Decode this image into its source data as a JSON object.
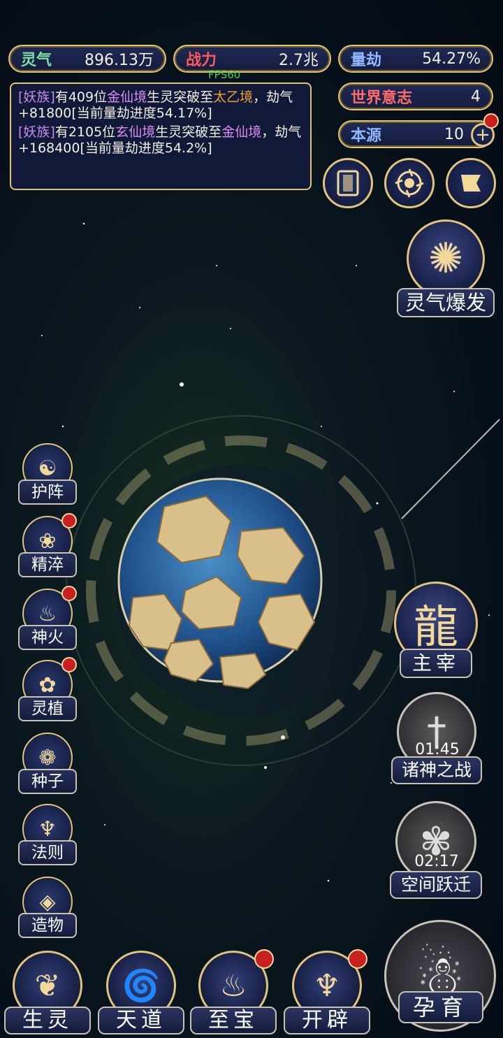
{
  "stats": {
    "lingqi": {
      "label": "灵气",
      "value": "896.13万",
      "color": "#7ee0a0"
    },
    "zhanli": {
      "label": "战力",
      "value": "2.7兆",
      "color": "#ff5a5a"
    },
    "liangjie": {
      "label": "量劫",
      "value": "54.27%",
      "color": "#8fb8ff"
    },
    "world_will": {
      "label": "世界意志",
      "value": "4",
      "color": "#ff6b6b"
    },
    "origin": {
      "label": "本源",
      "value": "10",
      "color": "#8fb8ff"
    }
  },
  "fps": "FPS60",
  "log": {
    "entry1": {
      "race": "[妖族]",
      "p1": "有409位",
      "realm_from": "金仙境",
      "p2": "生灵突破至",
      "realm_to": "太乙境",
      "p3": "，劫气+81800[当前量劫进度54.17%]"
    },
    "entry2": {
      "race": "[妖族]",
      "p1": "有2105位",
      "realm_from": "玄仙境",
      "p2": "生灵突破至",
      "realm_to": "金仙境",
      "p3": "，劫气+168400[当前量劫进度54.2%]"
    }
  },
  "top_icons": [
    "card-icon",
    "vortex-icon",
    "banner-icon"
  ],
  "burst": {
    "label": "灵气爆发"
  },
  "left_menu": [
    {
      "key": "huzhen",
      "label": "护阵",
      "icon": "☯",
      "dot": false
    },
    {
      "key": "jingcui",
      "label": "精淬",
      "icon": "❀",
      "dot": true
    },
    {
      "key": "shenhuo",
      "label": "神火",
      "icon": "♨",
      "dot": true
    },
    {
      "key": "lingzhi",
      "label": "灵植",
      "icon": "✿",
      "dot": true
    },
    {
      "key": "zhongzi",
      "label": "种子",
      "icon": "❁",
      "dot": false
    },
    {
      "key": "faze",
      "label": "法则",
      "icon": "♆",
      "dot": false
    },
    {
      "key": "zaowu",
      "label": "造物",
      "icon": "◈",
      "dot": false
    }
  ],
  "right_menu": {
    "zhuzai": {
      "label": "主宰"
    },
    "zhushen": {
      "label": "诸神之战",
      "timer": "01:45"
    },
    "kongjian": {
      "label": "空间跃迁",
      "timer": "02:17"
    },
    "yunyu": {
      "label": "孕育"
    }
  },
  "bottom_menu": [
    {
      "key": "shengling",
      "label": "生灵",
      "dot": false
    },
    {
      "key": "tiandao",
      "label": "天道",
      "dot": false
    },
    {
      "key": "zhibao",
      "label": "至宝",
      "dot": true
    },
    {
      "key": "kaipi",
      "label": "开辟",
      "dot": true
    }
  ]
}
